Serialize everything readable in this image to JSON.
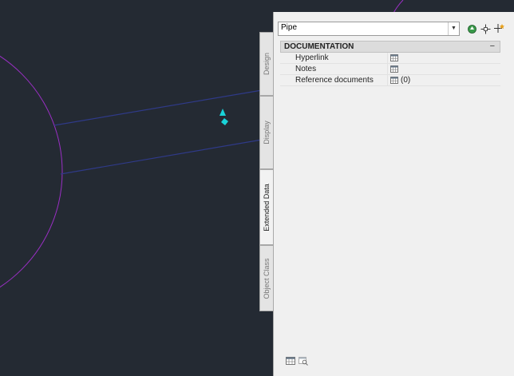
{
  "tabs": [
    {
      "label": "Design",
      "active": false
    },
    {
      "label": "Display",
      "active": false
    },
    {
      "label": "Extended Data",
      "active": true
    },
    {
      "label": "Object Class",
      "active": false
    }
  ],
  "style_select": {
    "value": "Pipe"
  },
  "toolbar_icons": [
    "select-style-icon",
    "pick-object-icon",
    "quick-select-icon"
  ],
  "section": {
    "title": "DOCUMENTATION",
    "collapse_symbol": "−"
  },
  "properties": [
    {
      "label": "Hyperlink",
      "value_icon": "table-icon",
      "value_text": ""
    },
    {
      "label": "Notes",
      "value_icon": "table-icon",
      "value_text": ""
    },
    {
      "label": "Reference documents",
      "value_icon": "table-icon",
      "value_text": "(0)"
    }
  ],
  "bottom_icons": [
    "table-icon",
    "table-zoom-icon"
  ],
  "colors": {
    "canvas_bg": "#242a33",
    "circle": "#9a2fc4",
    "lines": "#2f3a88",
    "marker": "#19d3d8",
    "arrow": "#2d3947"
  }
}
